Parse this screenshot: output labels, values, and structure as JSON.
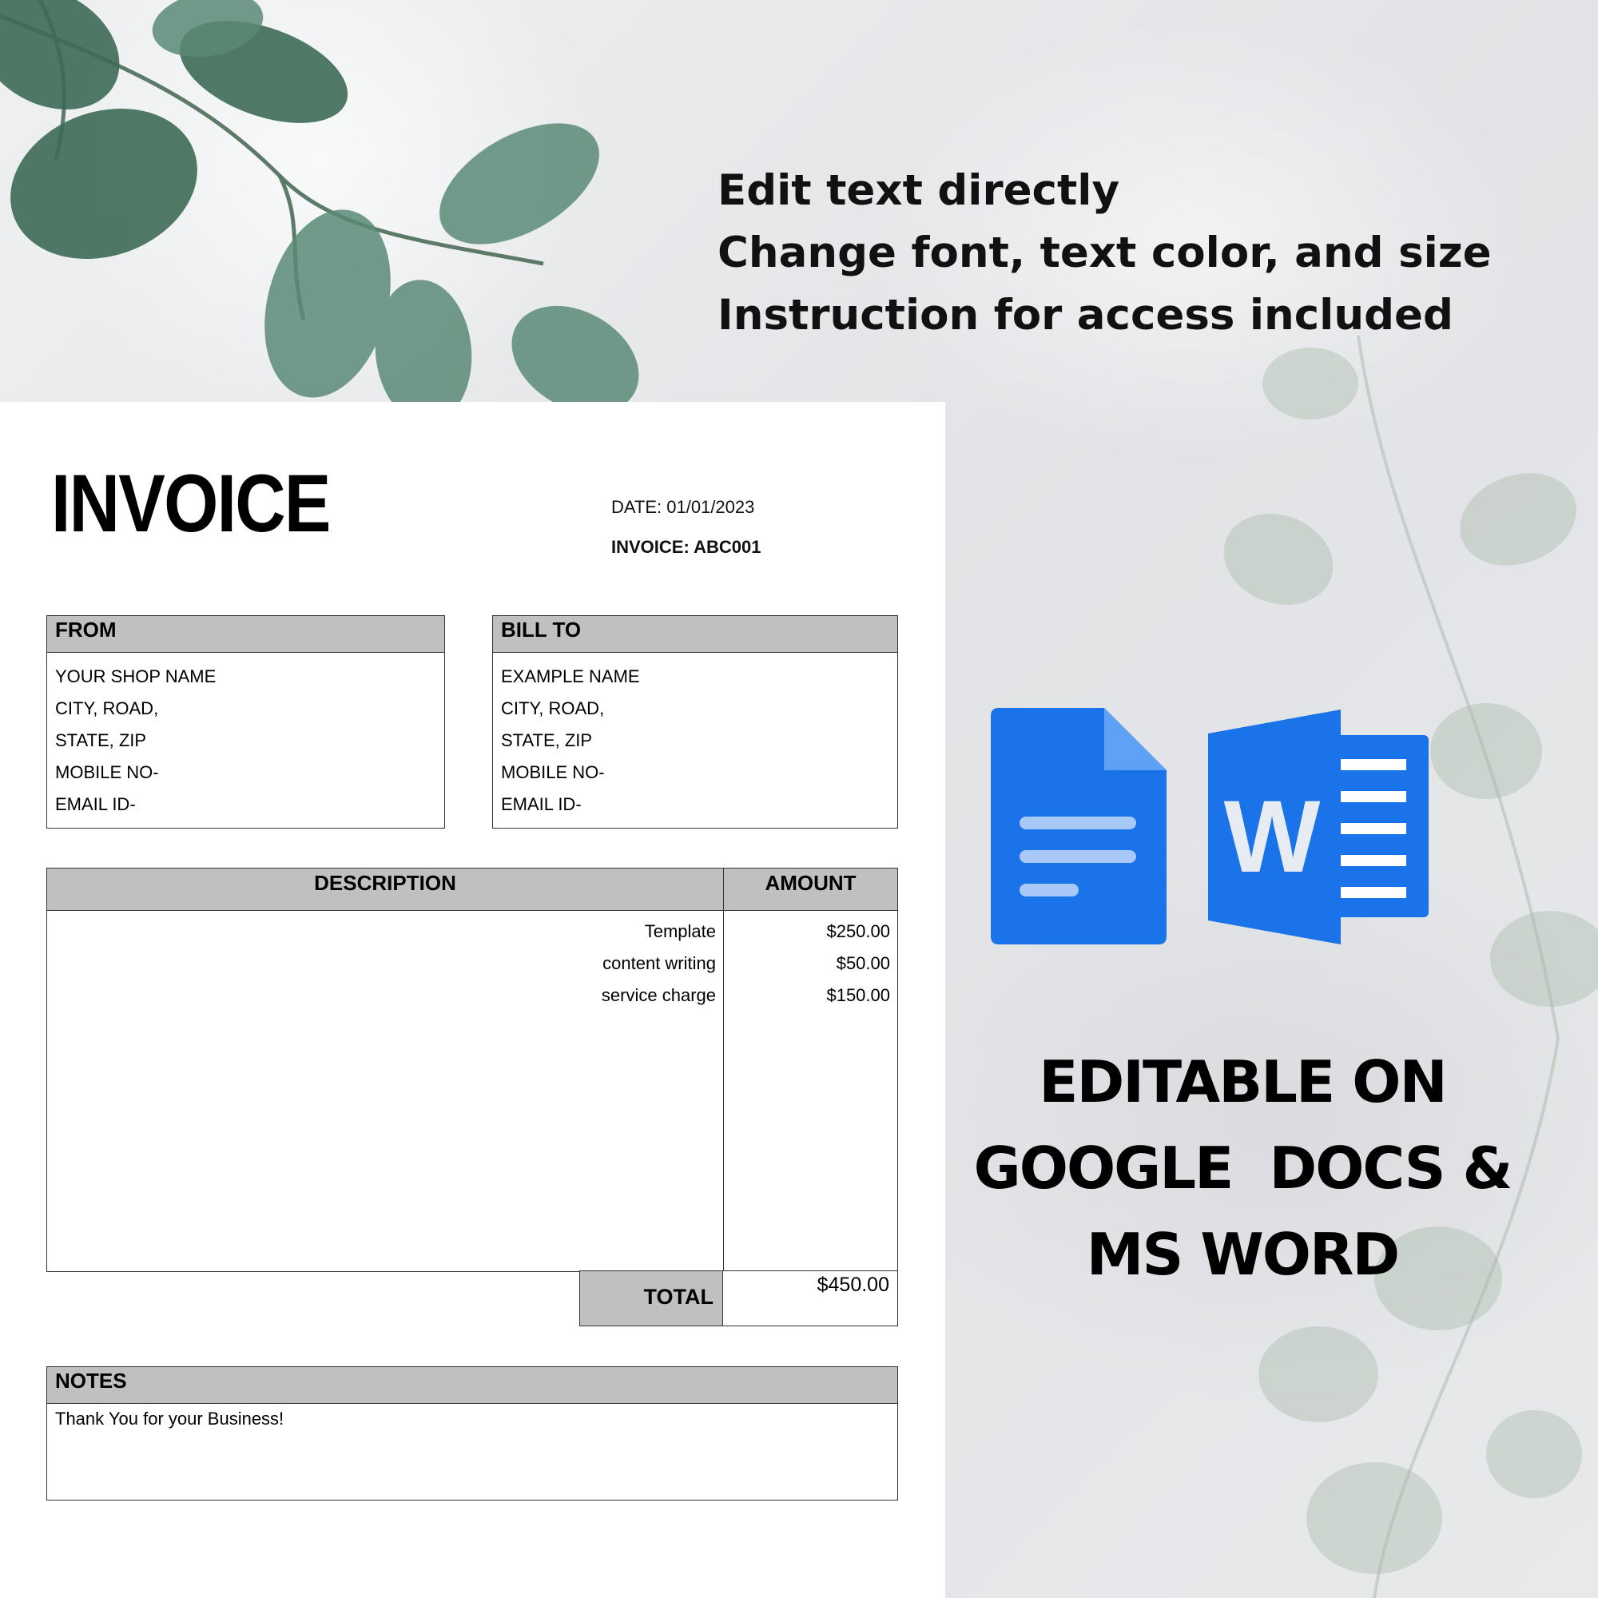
{
  "features": [
    "Edit text directly",
    "Change font, text color, and size",
    "Instruction for access included"
  ],
  "invoice": {
    "title": "INVOICE",
    "date_line": "DATE: 01/01/2023",
    "invoice_line": "INVOICE: ABC001",
    "from": {
      "heading": "FROM",
      "lines": [
        "YOUR SHOP NAME",
        "CITY, ROAD,",
        "STATE, ZIP",
        "MOBILE NO-",
        "EMAIL ID-"
      ]
    },
    "bill_to": {
      "heading": "BILL TO",
      "lines": [
        "EXAMPLE NAME",
        "CITY, ROAD,",
        "STATE, ZIP",
        "MOBILE NO-",
        "EMAIL ID-"
      ]
    },
    "table": {
      "description_header": "DESCRIPTION",
      "amount_header": "AMOUNT",
      "rows": [
        {
          "description": "Template",
          "amount": "$250.00"
        },
        {
          "description": "content writing",
          "amount": "$50.00"
        },
        {
          "description": "service charge",
          "amount": "$150.00"
        }
      ]
    },
    "total_label": "TOTAL",
    "total_value": "$450.00",
    "notes": {
      "heading": "NOTES",
      "text": "Thank You for your Business!"
    }
  },
  "icons": {
    "google_docs": "google-docs-icon",
    "ms_word": "ms-word-icon",
    "word_letter": "W",
    "accent": "#1a73e8"
  },
  "editable_lines": [
    "EDITABLE ON",
    "GOOGLE  DOCS &",
    "MS WORD"
  ]
}
